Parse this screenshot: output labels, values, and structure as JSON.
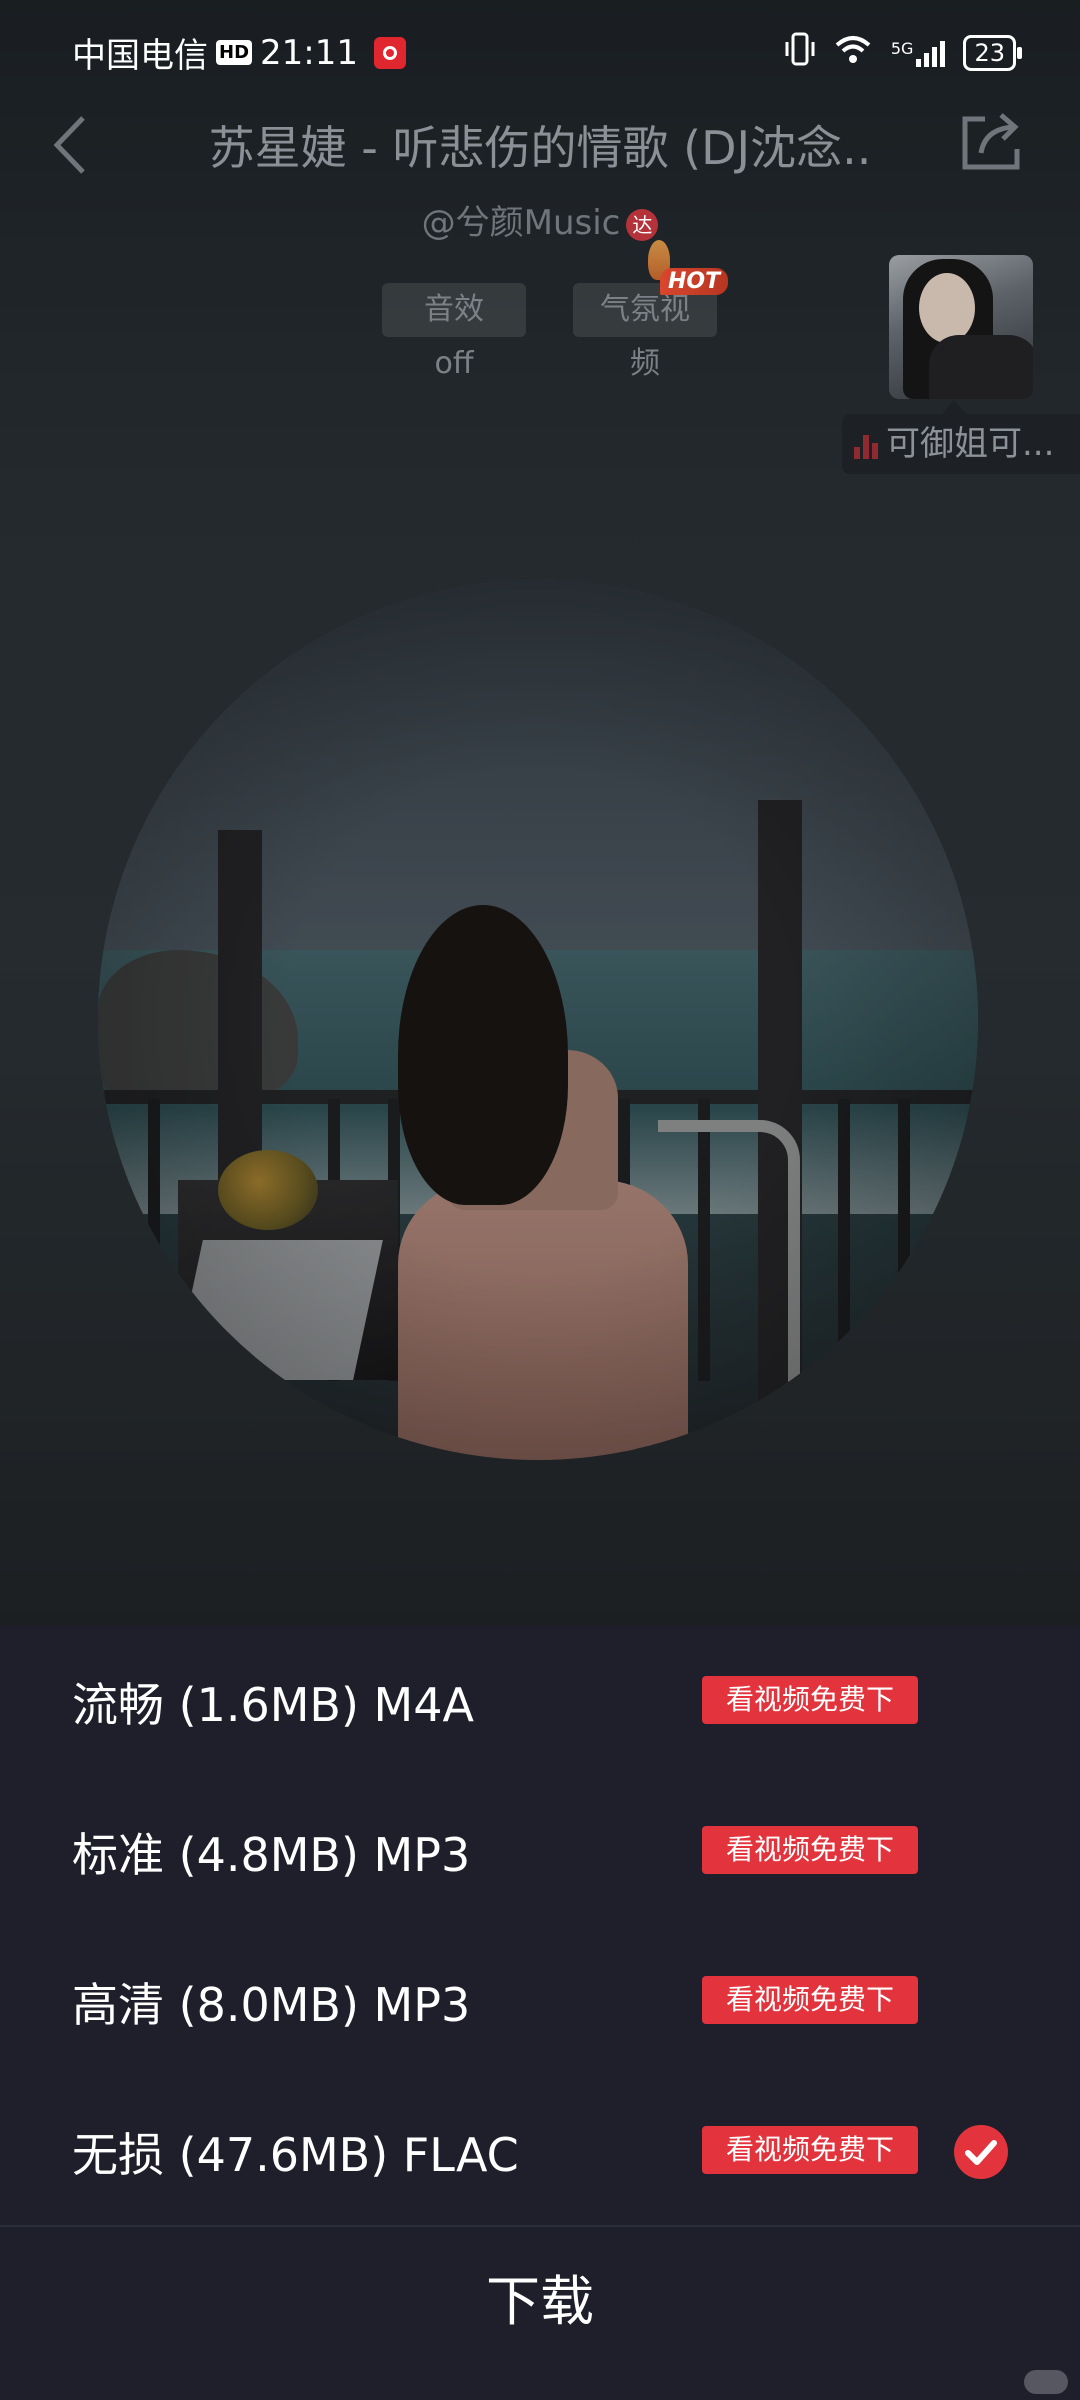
{
  "status_bar": {
    "carrier": "中国电信",
    "hd_badge": "HD",
    "time": "21:11",
    "network": "5G",
    "battery": "23"
  },
  "header": {
    "title": "苏星婕 - 听悲伤的情歌 (DJ沈念..",
    "author": "@兮颜Music",
    "author_badge": "达",
    "chip_effect": "音效 off",
    "chip_video": "气氛视频",
    "hot_label": "HOT",
    "thumb_label": "可御姐可..."
  },
  "quality_options": [
    {
      "label": "流畅 (1.6MB) M4A",
      "badge": "看视频免费下",
      "selected": false
    },
    {
      "label": "标准 (4.8MB) MP3",
      "badge": "看视频免费下",
      "selected": false
    },
    {
      "label": "高清 (8.0MB) MP3",
      "badge": "看视频免费下",
      "selected": false
    },
    {
      "label": "无损 (47.6MB) FLAC",
      "badge": "看视频免费下",
      "selected": true
    }
  ],
  "download_label": "下载",
  "colors": {
    "accent": "#e3343d",
    "sheet_bg": "#1e1f2b"
  }
}
